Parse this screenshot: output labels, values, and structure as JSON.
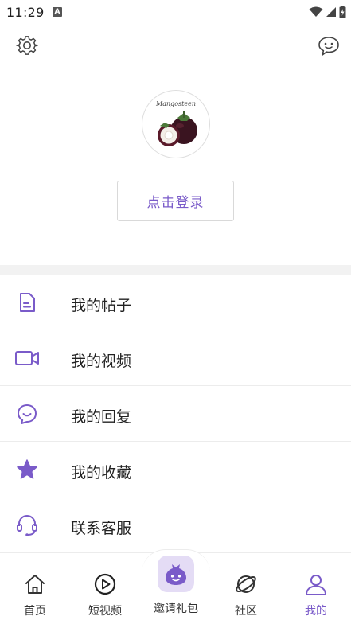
{
  "status_bar": {
    "time": "11:29",
    "notification_letter": "A"
  },
  "header": {
    "settings_icon": "gear-icon",
    "message_icon": "chat-bubble-icon"
  },
  "profile": {
    "avatar_caption": "Mangosteen",
    "login_label": "点击登录"
  },
  "menu": {
    "items": [
      {
        "label": "我的帖子",
        "icon": "document-icon"
      },
      {
        "label": "我的视频",
        "icon": "video-camera-icon"
      },
      {
        "label": "我的回复",
        "icon": "reply-bubble-icon"
      },
      {
        "label": "我的收藏",
        "icon": "star-icon"
      },
      {
        "label": "联系客服",
        "icon": "headset-icon"
      }
    ]
  },
  "tabs": {
    "items": [
      {
        "label": "首页",
        "icon": "home-icon"
      },
      {
        "label": "短视频",
        "icon": "play-circle-icon"
      },
      {
        "label": "邀请礼包",
        "icon": "gift-bag-icon"
      },
      {
        "label": "社区",
        "icon": "planet-icon"
      },
      {
        "label": "我的",
        "icon": "user-icon",
        "active": true
      }
    ]
  },
  "colors": {
    "accent": "#7a5bc9",
    "divider": "#f2f2f2",
    "invite_bg": "#e4dcf5"
  }
}
